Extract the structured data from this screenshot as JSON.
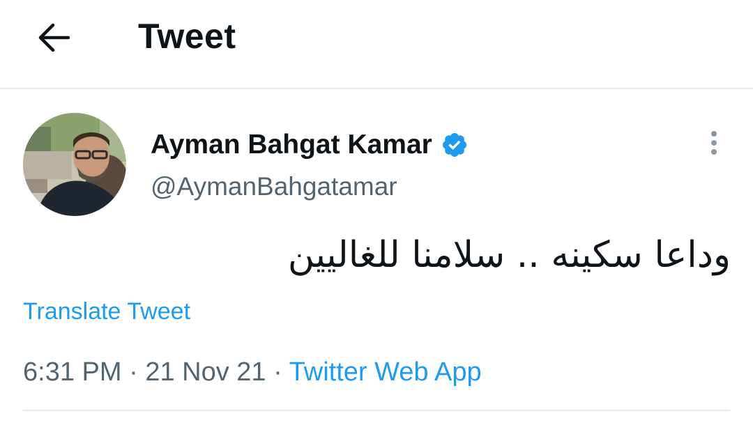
{
  "header": {
    "title": "Tweet",
    "back_icon": "arrow-left-icon"
  },
  "tweet": {
    "author": {
      "display_name": "Ayman Bahgat Kamar",
      "handle": "@AymanBahgatamar",
      "verified": true,
      "verified_icon": "verified-badge-icon"
    },
    "text": "وداعا سكينه .. سلامنا للغاليين",
    "translate_label": "Translate Tweet",
    "time": "6:31 PM",
    "separator": "·",
    "date": "21 Nov 21",
    "source": "Twitter Web App",
    "more_icon": "more-vertical-icon"
  },
  "colors": {
    "accent": "#1d9bf0",
    "text_primary": "#0f1419",
    "text_secondary": "#536471",
    "divider": "#e6e9eb"
  }
}
